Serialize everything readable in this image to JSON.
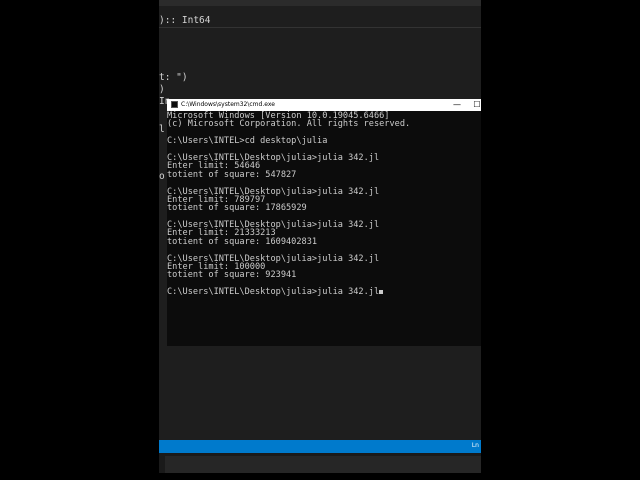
{
  "editor": {
    "lines": [
      {
        "text": "):: Int64",
        "cls": "yellow"
      },
      {
        "text": "t: \")",
        "cls": "yellow"
      },
      {
        "text": ")",
        "cls": "gold"
      },
      {
        "text": "In",
        "cls": "blue"
      },
      {
        "text": "l",
        "cls": "blue"
      },
      {
        "text": "o",
        "cls": "orange"
      }
    ]
  },
  "cmd": {
    "title": "C:\\Windows\\system32\\cmd.exe",
    "min_glyph": "—",
    "max_glyph": "☐",
    "lines": [
      "Microsoft Windows [Version 10.0.19045.6466]",
      "(c) Microsoft Corporation. All rights reserved.",
      "",
      "C:\\Users\\INTEL>cd desktop\\julia",
      "",
      "C:\\Users\\INTEL\\Desktop\\julia>julia 342.jl",
      "Enter limit: 54646",
      "totient of square: 547827",
      "",
      "C:\\Users\\INTEL\\Desktop\\julia>julia 342.jl",
      "Enter limit: 789797",
      "totient of square: 17865929",
      "",
      "C:\\Users\\INTEL\\Desktop\\julia>julia 342.jl",
      "Enter limit: 21333213",
      "totient of square: 1609402831",
      "",
      "C:\\Users\\INTEL\\Desktop\\julia>julia 342.jl",
      "Enter limit: 100000",
      "totient of square: 923941",
      "",
      "C:\\Users\\INTEL\\Desktop\\julia>julia 342.jl"
    ]
  },
  "statusbar": {
    "text": "Ln"
  }
}
